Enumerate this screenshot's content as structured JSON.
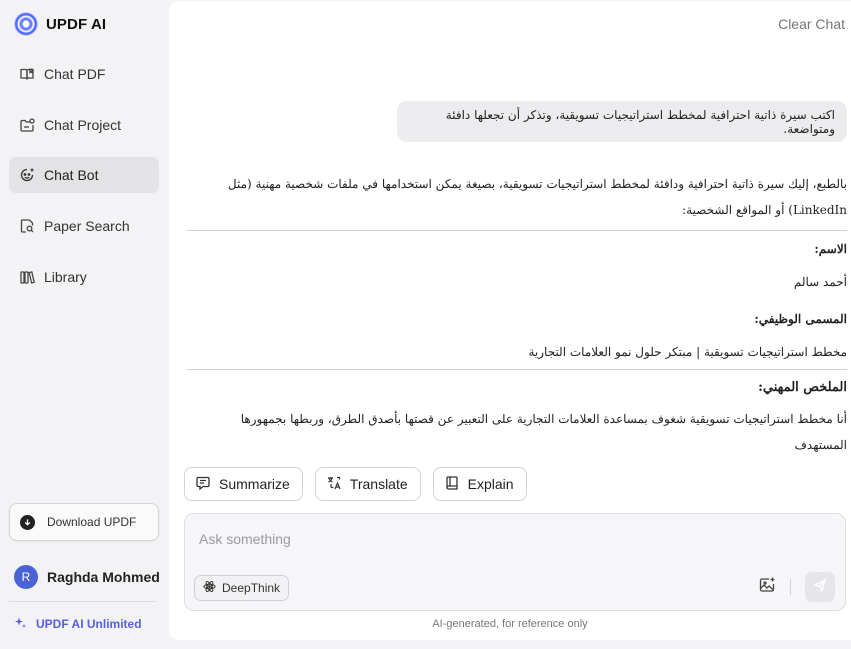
{
  "brand": {
    "name": "UPDF AI"
  },
  "sidebar": {
    "items": [
      {
        "label": "Chat PDF",
        "icon": "book-open-icon",
        "active": false
      },
      {
        "label": "Chat Project",
        "icon": "folder-chat-icon",
        "active": false
      },
      {
        "label": "Chat Bot",
        "icon": "bot-face-icon",
        "active": true
      },
      {
        "label": "Paper Search",
        "icon": "document-search-icon",
        "active": false
      },
      {
        "label": "Library",
        "icon": "library-books-icon",
        "active": false
      }
    ],
    "download_label": "Download UPDF",
    "user": {
      "initial": "R",
      "name": "Raghda Mohmed"
    },
    "unlimited_label": "UPDF AI Unlimited"
  },
  "header": {
    "clear_chat": "Clear Chat"
  },
  "conversation": {
    "user_message": "اكتب سيرة ذاتية احترافية لمخطط استراتيجيات تسويقية، وتذكر أن تجعلها دافئة ومتواضعة.",
    "answer": {
      "intro": "بالطبع، إليك سيرة ذاتية احترافية ودافئة لمخطط استراتيجيات تسويقية، بصيغة يمكن استخدامها في ملفات شخصية مهنية (مثل LinkedIn) أو المواقع الشخصية:",
      "name_label": "الاسم:",
      "name_value": "أحمد سالم",
      "title_label": "المسمى الوظيفي:",
      "title_value": "مخطط استراتيجيات تسويقية | مبتكر حلول نمو العلامات التجارية",
      "summary_label": "الملخص المهني:",
      "summary_body": "أنا مخطط استراتيجيات تسويقية شغوف بمساعدة العلامات التجارية على التعبير عن قصتها بأصدق الطرق، وربطها بجمهورها المستهدف"
    }
  },
  "actions": [
    {
      "label": "Summarize",
      "icon": "summarize-icon"
    },
    {
      "label": "Translate",
      "icon": "translate-icon"
    },
    {
      "label": "Explain",
      "icon": "book-icon"
    }
  ],
  "composer": {
    "placeholder": "Ask something",
    "value": "",
    "deepthink_label": "DeepThink"
  },
  "footer": {
    "note": "AI-generated, for reference only"
  },
  "colors": {
    "accent": "#5660e0",
    "avatar": "#4a63d6",
    "sidebar_bg": "#f3f3f5",
    "active_item_bg": "#e3e3e6",
    "bubble_bg": "#ececee"
  }
}
